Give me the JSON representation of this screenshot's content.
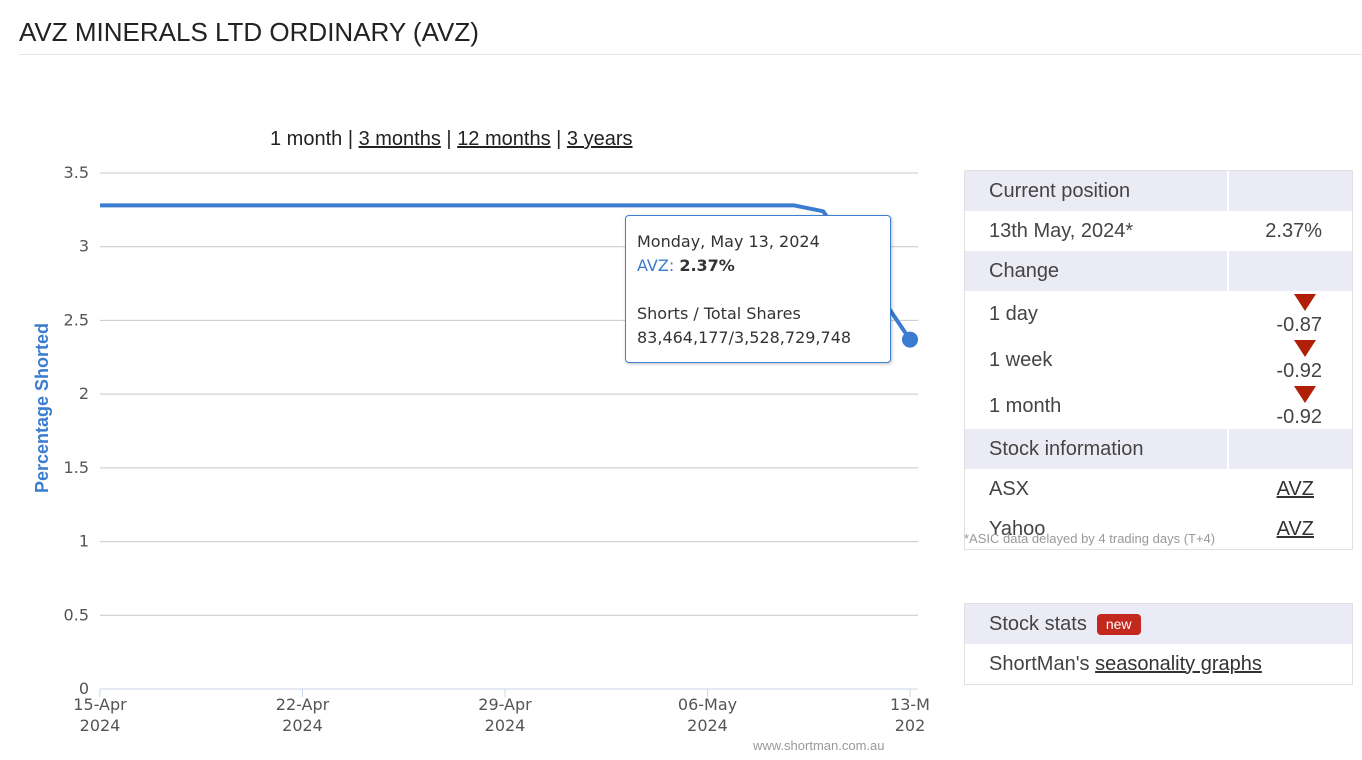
{
  "page": {
    "title": "AVZ MINERALS LTD ORDINARY (AVZ)"
  },
  "range_nav": {
    "current": "1 month",
    "links": [
      "3 months",
      "12 months",
      "3 years"
    ],
    "separator": "|"
  },
  "chart_data": {
    "type": "line",
    "ylabel": "Percentage Shorted",
    "ylim": [
      0,
      3.5
    ],
    "y_ticks": [
      "0",
      "0.5",
      "1",
      "1.5",
      "2",
      "2.5",
      "3",
      "3.5"
    ],
    "x_ticks": [
      {
        "date": "2024-04-15",
        "line1": "15-Apr",
        "line2": "2024"
      },
      {
        "date": "2024-04-22",
        "line1": "22-Apr",
        "line2": "2024"
      },
      {
        "date": "2024-04-29",
        "line1": "29-Apr",
        "line2": "2024"
      },
      {
        "date": "2024-05-06",
        "line1": "06-May",
        "line2": "2024"
      },
      {
        "date": "2024-05-13",
        "line1": "13-M",
        "line2": "202"
      }
    ],
    "xlim": [
      "2024-04-15",
      "2024-05-13"
    ],
    "series": [
      {
        "name": "AVZ",
        "color": "#3a7cd0",
        "points": [
          {
            "x": "2024-04-15",
            "y": 3.28
          },
          {
            "x": "2024-04-22",
            "y": 3.28
          },
          {
            "x": "2024-04-29",
            "y": 3.28
          },
          {
            "x": "2024-05-06",
            "y": 3.28
          },
          {
            "x": "2024-05-09",
            "y": 3.28
          },
          {
            "x": "2024-05-10",
            "y": 3.24
          },
          {
            "x": "2024-05-13",
            "y": 2.37
          }
        ]
      }
    ],
    "grid": true,
    "watermark": "www.shortman.com.au",
    "tooltip": {
      "date": "Monday, May 13, 2024",
      "series": "AVZ",
      "value": "2.37%",
      "label": "Shorts / Total Shares",
      "ratio": "83,464,177/3,528,729,748"
    }
  },
  "position_table": {
    "current_header": "Current position",
    "current_date": "13th May, 2024*",
    "current_value": "2.37%",
    "change_header": "Change",
    "changes": [
      {
        "label": "1 day",
        "value": "-0.87"
      },
      {
        "label": "1 week",
        "value": "-0.92"
      },
      {
        "label": "1 month",
        "value": "-0.92"
      }
    ],
    "info_header": "Stock information",
    "info": [
      {
        "label": "ASX",
        "link": "AVZ"
      },
      {
        "label": "Yahoo",
        "link": "AVZ"
      }
    ],
    "down_color": "#b02008",
    "footnote": "*ASIC data delayed by 4 trading days (T+4)"
  },
  "stats_panel": {
    "header": "Stock stats",
    "badge": "new",
    "text": "ShortMan's",
    "link": "seasonality graphs"
  }
}
